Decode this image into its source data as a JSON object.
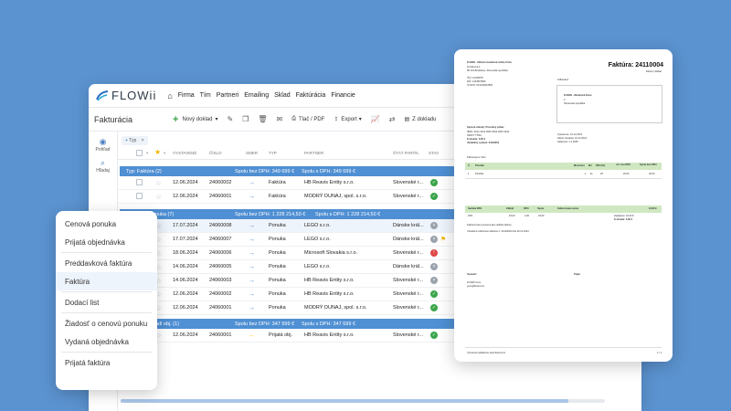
{
  "app": {
    "logo": "FLOWii",
    "nav": [
      "Firma",
      "Tím",
      "Partneri",
      "Emailing",
      "Sklad",
      "Faktúrácia",
      "Financie"
    ],
    "page_title": "Fakturácia",
    "toolbar": {
      "new_doc": "Nový doklad",
      "print": "Tlač / PDF",
      "export": "Export",
      "from_doc": "Z dokladu"
    },
    "side": [
      {
        "label": "Pohľad"
      },
      {
        "label": "Hľadaj"
      }
    ],
    "filter_chip": {
      "prefix": "+",
      "label": "Typ"
    },
    "columns": [
      "VYSTAVENÉ",
      "ČÍSLO",
      "SMER",
      "TYP",
      "PARTNER",
      "ŠTÁT PARTN.",
      "STAV"
    ],
    "groups": [
      {
        "label": "Typ: Faktúra (2)",
        "without_vat": "Spolu bez DPH: 349 699 €",
        "with_vat": "Spolu s DPH: 349 699 €"
      },
      {
        "label": "nuka (7)",
        "without_vat": "Spolu bez DPH: 1 228 214,50 €",
        "with_vat": "Spolu s DPH: 1 228 214,50 €"
      },
      {
        "label": "adl obj. (1)",
        "without_vat": "Spolu bez DPH: 347 699 €",
        "with_vat": "Spolu s DPH: 347 699 €"
      }
    ],
    "rows": [
      {
        "date": "12.06.2024",
        "number": "24060002",
        "type": "Faktúra",
        "partner": "HB Reavis Entity s.r.o.",
        "state": "Slovenské r...",
        "status": "green"
      },
      {
        "date": "12.06.2024",
        "number": "24060001",
        "type": "Faktúra",
        "partner": "MODRÝ DUNAJ, spol. s.r.o.",
        "state": "Slovenské r...",
        "status": "green"
      },
      {
        "date": "17.07.2024",
        "number": "24060008",
        "type": "Ponuka",
        "partner": "LEGO s.r.o.",
        "state": "Dánske král...",
        "status": "gray"
      },
      {
        "date": "17.07.2024",
        "number": "24060007",
        "type": "Ponuka",
        "partner": "LEGO s.r.o.",
        "state": "Dánske král...",
        "status": "gray"
      },
      {
        "date": "18.06.2024",
        "number": "24060006",
        "type": "Ponuka",
        "partner": "Microsoft Slovakia s.r.o.",
        "state": "Slovenské r...",
        "status": "red"
      },
      {
        "date": "14.06.2024",
        "number": "24060005",
        "type": "Ponuka",
        "partner": "LEGO s.r.o.",
        "state": "Dánske král...",
        "status": "gray"
      },
      {
        "date": "14.06.2024",
        "number": "24060003",
        "type": "Ponuka",
        "partner": "HB Reavis Entity s.r.o.",
        "state": "Slovenské r...",
        "status": "gray"
      },
      {
        "date": "12.06.2024",
        "number": "24060002",
        "type": "Ponuka",
        "partner": "HB Reavis Entity s.r.o.",
        "state": "Slovenské r...",
        "status": "green"
      },
      {
        "date": "12.06.2024",
        "number": "24060001",
        "type": "Ponuka",
        "partner": "MODRÝ DUNAJ, spol. s.r.o.",
        "state": "Slovenské r...",
        "status": "green"
      },
      {
        "date": "12.06.2024",
        "number": "24060001",
        "type": "Prijatá obj.",
        "partner": "HB Reavis Entity s.r.o.",
        "state": "Slovenské r...",
        "status": "green"
      }
    ]
  },
  "menu": {
    "items": [
      "Cenová ponuka",
      "Prijatá objednávka",
      "Preddavková faktúra",
      "Faktúra",
      "Dodací list",
      "Žiadosť o cenovú ponuku",
      "Vydaná objednávka",
      "Prijatá faktúra"
    ]
  },
  "invoice": {
    "title": "Faktúra: 24110004",
    "subtitle": "Daňový doklad",
    "supplier_name": "FLOWii - fiktívna modelová online firma",
    "supplier_lines": [
      "Fontánová 1",
      "85 101 Bratislava, Slovenská republika",
      "IČO: 12345678",
      "DIČ: 1234567890",
      "IČ DPH: SK1234567890"
    ],
    "customer_label": "Odberateľ:",
    "customer_name": "FLOWii - Modelová firma",
    "customer_lines": [
      "2",
      "Slovenská republika"
    ],
    "payment_title": "Spôsob úhrady: Prevodný príkaz",
    "payment_lines": [
      "IBAN: SK11 2222 0000 3333 0000 4444",
      "SWIFT: TTRA",
      "K úhrade: 5,00 €",
      "Variabilný symbol: 24110004"
    ],
    "dates": [
      "Vystavenie: 19.12.2024",
      "Dátum dodania: 19.12.2024",
      "Splatnosť: 1.1.2025"
    ],
    "items_label": "Fakturujeme Vám:",
    "items_header": [
      "Č.",
      "Položka",
      "Množstvo",
      "MJ",
      "DPH (%)",
      "J.C. bez DPH",
      "Spolu bez DPH"
    ],
    "item_row": [
      "1",
      "Položka",
      "1",
      "ks",
      "20",
      "20,00",
      "20,00"
    ],
    "vat_header": [
      "Sadzba DPH",
      "Základ",
      "DPH",
      "Spolu",
      "Fakturovaná suma",
      "24,00 €"
    ],
    "vat_row": [
      "20%",
      "20,00",
      "4,00",
      "24,00"
    ],
    "vat_totals": [
      "Zaplatené: 19,00 €",
      "K úhrade: 5,00 €"
    ],
    "notes": [
      "Faktúra bola vytvorená ako ukážka faktúry.",
      "Uhradené zálohovou faktúrou č. 24110003 dňa 19.12.2024"
    ],
    "issued_by": "Vystavil:",
    "received_by": "Prijal:",
    "issuer_lines": [
      "FLOWii Guru",
      "guru@flowii.com"
    ],
    "footer_left": "Vytvorené aplikáciou www.flowii.com",
    "footer_right": "1 / 1"
  }
}
